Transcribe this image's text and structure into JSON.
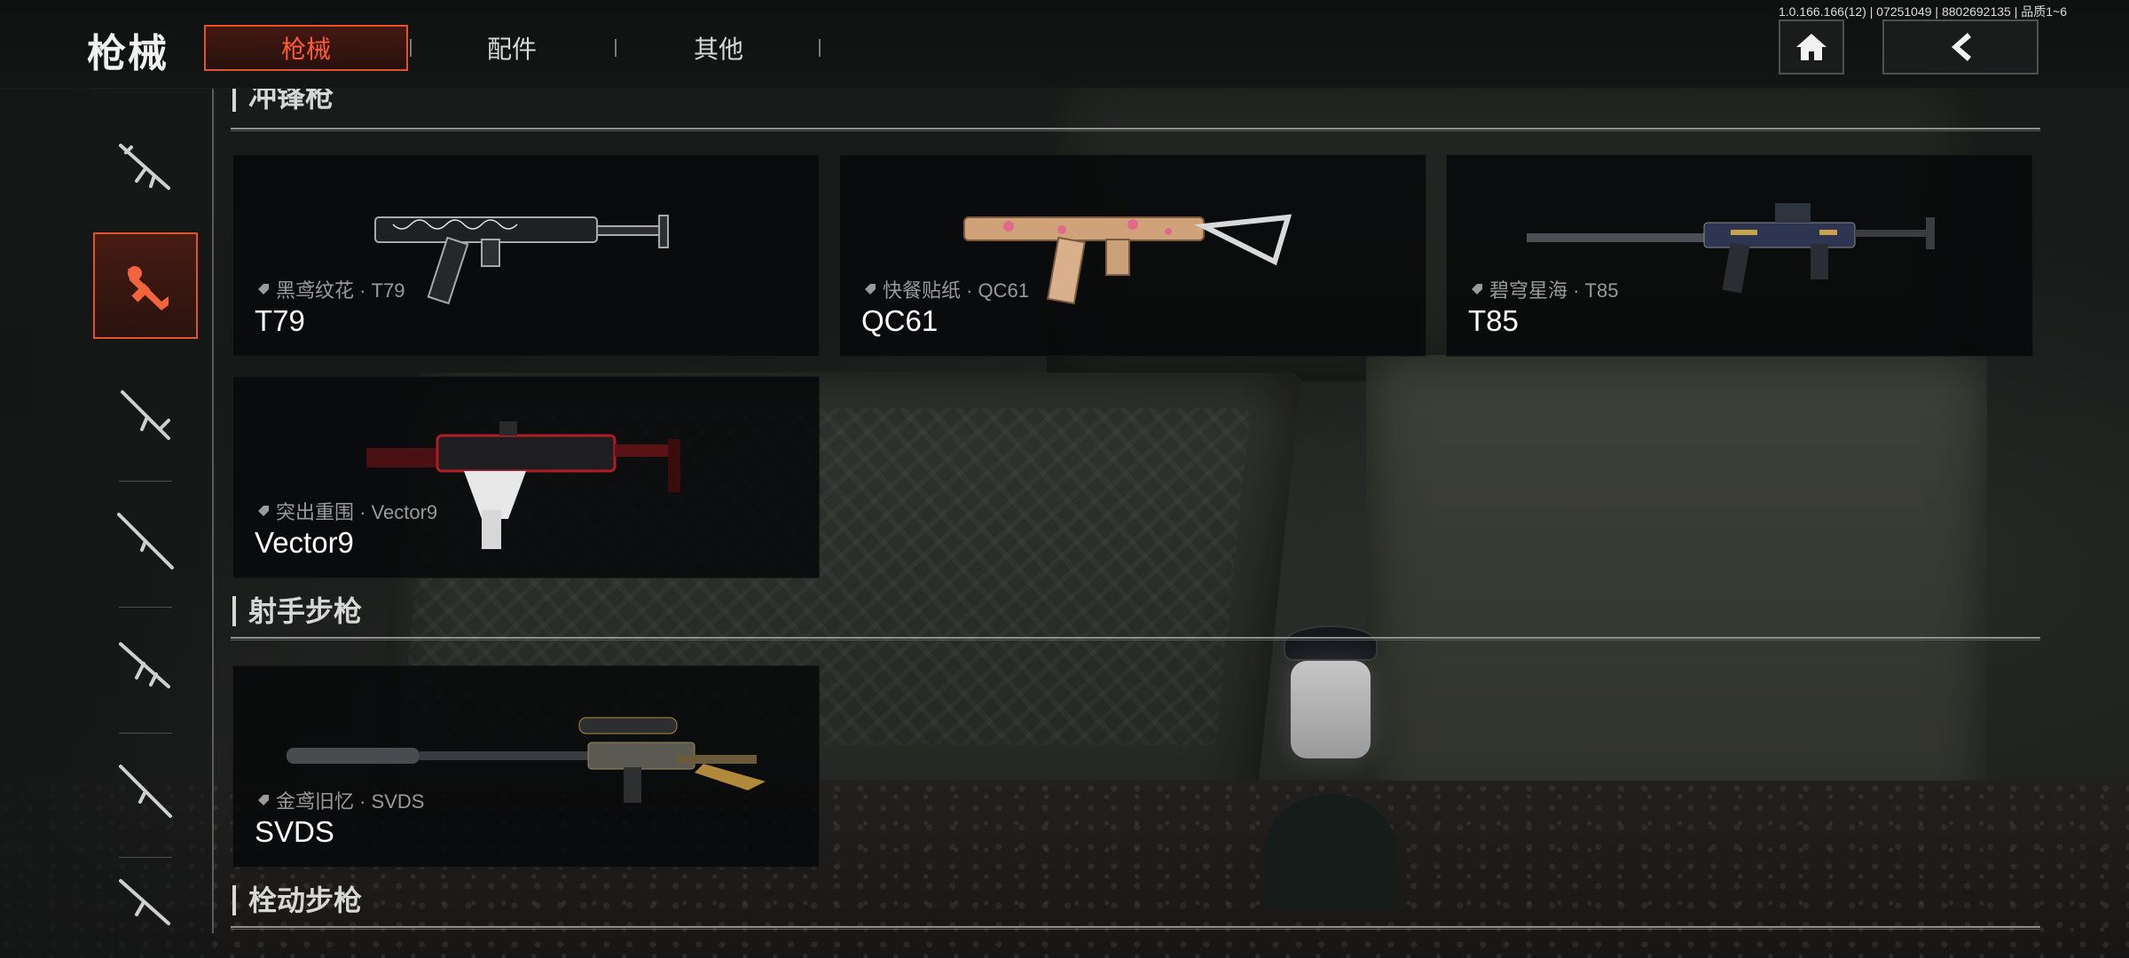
{
  "header": {
    "title": "枪械",
    "tabs": [
      {
        "label": "枪械",
        "active": true
      },
      {
        "label": "配件",
        "active": false
      },
      {
        "label": "其他",
        "active": false
      }
    ],
    "version": "1.0.166.166(12) | 07251049 | 8802692135 | 品质1~6",
    "home_icon": "home-icon",
    "back_icon": "chevron-left-icon"
  },
  "sidebar": {
    "categories": [
      {
        "icon": "assault-rifle-icon",
        "active": false
      },
      {
        "icon": "smg-icon",
        "active": true
      },
      {
        "icon": "marksman-rifle-icon",
        "active": false
      },
      {
        "icon": "sniper-rifle-icon",
        "active": false
      },
      {
        "icon": "shotgun-icon",
        "active": false
      },
      {
        "icon": "lmg-icon",
        "active": false
      },
      {
        "icon": "bolt-rifle-icon",
        "active": false
      }
    ]
  },
  "sections": [
    {
      "title": "冲锋枪",
      "cards": [
        {
          "skin": "黑鸢纹花 · T79",
          "name": "T79"
        },
        {
          "skin": "快餐贴纸 · QC61",
          "name": "QC61"
        },
        {
          "skin": "碧穹星海 · T85",
          "name": "T85"
        },
        {
          "skin": "突出重围 · Vector9",
          "name": "Vector9"
        }
      ]
    },
    {
      "title": "射手步枪",
      "cards": [
        {
          "skin": "金鸢旧忆 · SVDS",
          "name": "SVDS"
        }
      ]
    },
    {
      "title": "栓动步枪",
      "cards": []
    }
  ],
  "colors": {
    "accent": "#e2522d",
    "card_bg": "#08090a",
    "text": "#ffffff"
  }
}
